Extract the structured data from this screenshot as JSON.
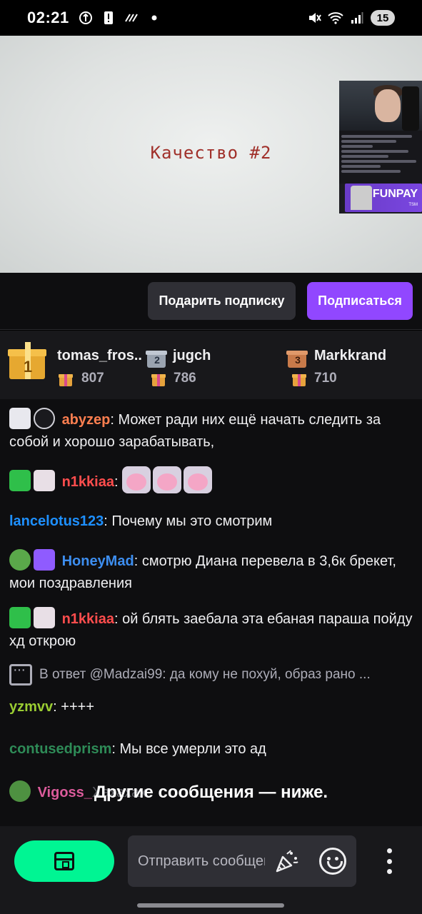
{
  "status_bar": {
    "time": "02:21",
    "battery": "15",
    "left_icons": [
      "shield-icon",
      "alert-icon",
      "signal-lines-icon",
      "dot-icon"
    ],
    "right_icons": [
      "mute-icon",
      "wifi-icon",
      "cell-signal-icon"
    ]
  },
  "video": {
    "overlay_text": "Качество #2",
    "pip_banner_text": "FUNPAY",
    "pip_banner_sub": "TSM"
  },
  "actions": {
    "gift_label": "Подарить подписку",
    "subscribe_label": "Подписаться",
    "subscribe_color": "#9147ff"
  },
  "leaderboard": [
    {
      "rank": "1",
      "name": "tomas_fros..",
      "count": "807"
    },
    {
      "rank": "2",
      "name": "jugch",
      "count": "786"
    },
    {
      "rank": "3",
      "name": "Markkrand",
      "count": "710"
    }
  ],
  "chat": {
    "messages": [
      {
        "user": "abyzep",
        "sep": ": ",
        "text": "Может ради них ещё начать следить за собой и хорошо зарабатывать,",
        "color": "#ff7f50"
      },
      {
        "user": "n1kkiaa",
        "sep": ": ",
        "text": "",
        "color": "#ff4d4d"
      },
      {
        "user": "lancelotus123",
        "sep": ": ",
        "text": "Почему мы это смотрим",
        "color": "#1e90ff"
      },
      {
        "user": "HoneyMad",
        "sep": ": ",
        "text": "смотрю Диана перевела в 3,6к брекет, мои поздравления",
        "color": "#3d8ef0"
      },
      {
        "user": "n1kkiaa",
        "sep": ": ",
        "text": "ой блять заебала эта ебаная параша пойду хд открою",
        "color": "#ff4d4d"
      },
      {
        "user": "yzmvv",
        "sep": ":  ",
        "text": "++++",
        "color": "#9acd32"
      },
      {
        "user": "contusedprism",
        "sep": ": ",
        "text": "Мы все умерли это ад",
        "color": "#2e8b57"
      },
      {
        "user": "Vigoss_",
        "sep": "",
        "text": "Хахахах",
        "color": "#ff69b4"
      }
    ],
    "reply_text": "В ответ @Madzai99: да кому не похуй, образ рано ...",
    "more_below": "Другие сообщения — ниже."
  },
  "input": {
    "placeholder": "Отправить сообщение",
    "chest_color": "#00f593"
  }
}
